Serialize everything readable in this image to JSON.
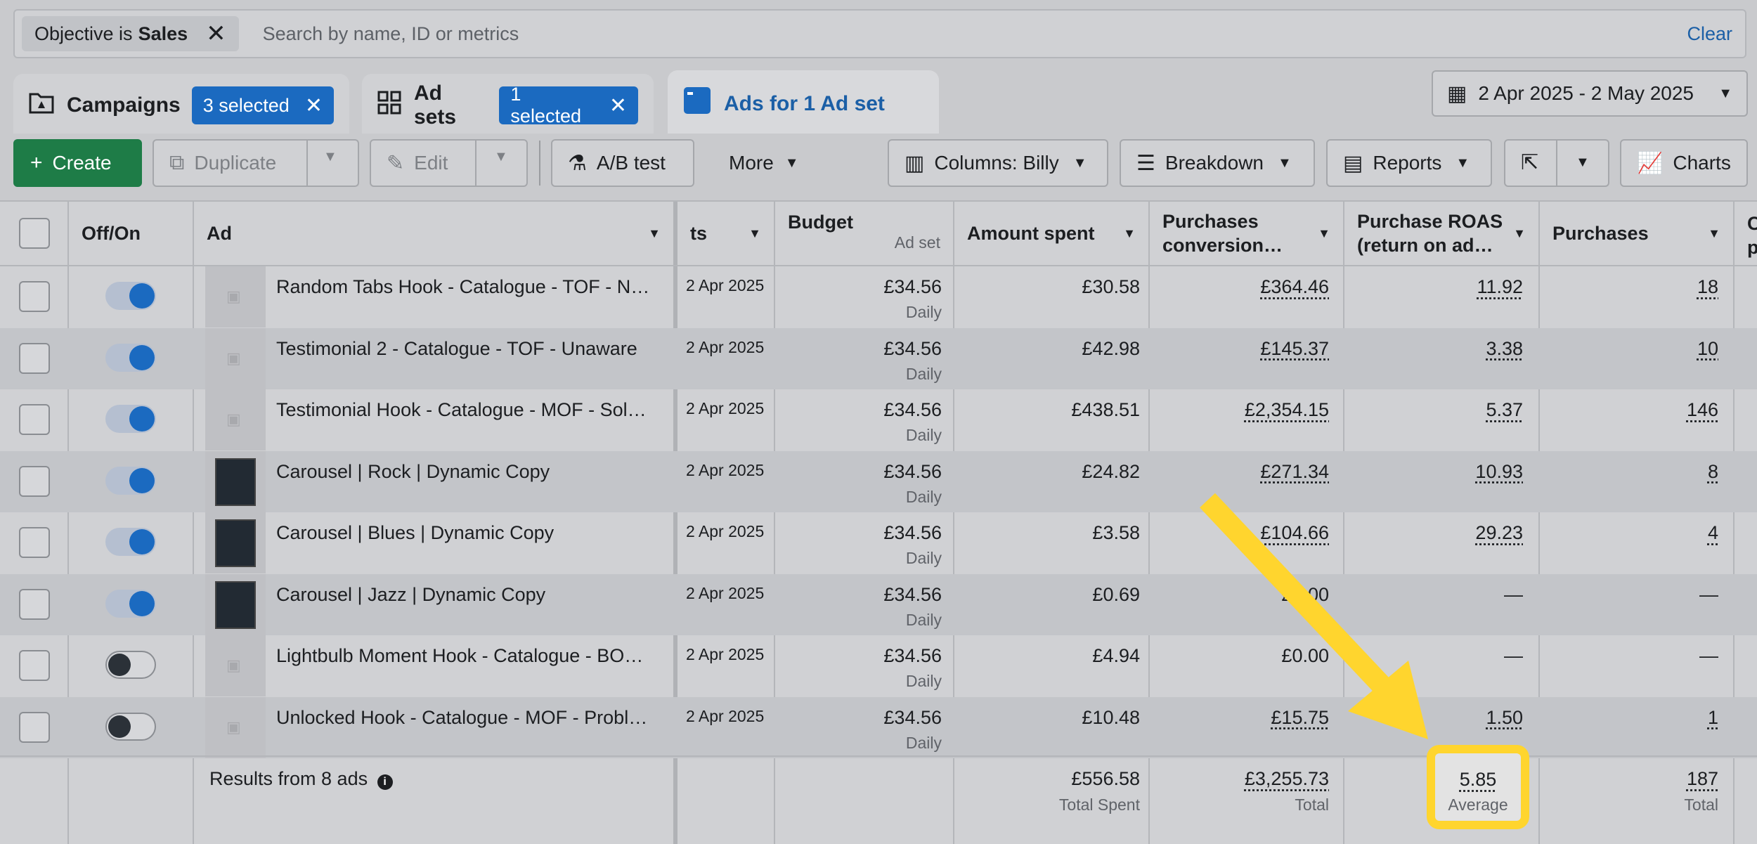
{
  "filter": {
    "chip_prefix": "Objective is",
    "chip_value": "Sales",
    "search_placeholder": "Search by name, ID or metrics",
    "clear": "Clear"
  },
  "tabs": {
    "campaigns": "Campaigns",
    "campaigns_selected": "3 selected",
    "adsets": "Ad sets",
    "adsets_selected": "1 selected",
    "ads": "Ads for 1 Ad set"
  },
  "date_range": "2 Apr 2025 - 2 May 2025",
  "toolbar": {
    "create": "Create",
    "duplicate": "Duplicate",
    "edit": "Edit",
    "ab_test": "A/B test",
    "more": "More",
    "columns": "Columns: Billy",
    "breakdown": "Breakdown",
    "reports": "Reports",
    "charts": "Charts"
  },
  "headers": {
    "offon": "Off/On",
    "ad": "Ad",
    "starts": "ts",
    "budget": "Budget",
    "budget_sub": "Ad set",
    "amount_spent": "Amount spent",
    "purchases_value_1": "Purchases",
    "purchases_value_2": "conversion…",
    "roas_1": "Purchase ROAS",
    "roas_2": "(return on ad…",
    "purchases": "Purchases",
    "next_1": "C",
    "next_2": "p"
  },
  "rows": [
    {
      "name": "Random Tabs Hook - Catalogue - TOF - N…",
      "start": "2 Apr 2025",
      "budget": "£34.56",
      "budget_sub": "Daily",
      "spent": "£30.58",
      "value": "£364.46",
      "roas": "11.92",
      "purchases": "18",
      "on": true,
      "thumb": "placeholder"
    },
    {
      "name": "Testimonial 2 - Catalogue - TOF - Unaware",
      "start": "2 Apr 2025",
      "budget": "£34.56",
      "budget_sub": "Daily",
      "spent": "£42.98",
      "value": "£145.37",
      "roas": "3.38",
      "purchases": "10",
      "on": true,
      "thumb": "placeholder"
    },
    {
      "name": "Testimonial Hook - Catalogue - MOF - Sol…",
      "start": "2 Apr 2025",
      "budget": "£34.56",
      "budget_sub": "Daily",
      "spent": "£438.51",
      "value": "£2,354.15",
      "roas": "5.37",
      "purchases": "146",
      "on": true,
      "thumb": "placeholder"
    },
    {
      "name": "Carousel | Rock | Dynamic Copy",
      "start": "2 Apr 2025",
      "budget": "£34.56",
      "budget_sub": "Daily",
      "spent": "£24.82",
      "value": "£271.34",
      "roas": "10.93",
      "purchases": "8",
      "on": true,
      "thumb": "image"
    },
    {
      "name": "Carousel | Blues | Dynamic Copy",
      "start": "2 Apr 2025",
      "budget": "£34.56",
      "budget_sub": "Daily",
      "spent": "£3.58",
      "value": "£104.66",
      "roas": "29.23",
      "purchases": "4",
      "on": true,
      "thumb": "image"
    },
    {
      "name": "Carousel | Jazz | Dynamic Copy",
      "start": "2 Apr 2025",
      "budget": "£34.56",
      "budget_sub": "Daily",
      "spent": "£0.69",
      "value": "£0.00",
      "roas": "—",
      "purchases": "—",
      "on": true,
      "thumb": "image"
    },
    {
      "name": "Lightbulb Moment Hook - Catalogue - BO…",
      "start": "2 Apr 2025",
      "budget": "£34.56",
      "budget_sub": "Daily",
      "spent": "£4.94",
      "value": "£0.00",
      "roas": "—",
      "purchases": "—",
      "on": false,
      "thumb": "placeholder"
    },
    {
      "name": "Unlocked Hook - Catalogue - MOF - Probl…",
      "start": "2 Apr 2025",
      "budget": "£34.56",
      "budget_sub": "Daily",
      "spent": "£10.48",
      "value": "£15.75",
      "roas": "1.50",
      "purchases": "1",
      "on": false,
      "thumb": "placeholder"
    }
  ],
  "totals": {
    "label": "Results from 8 ads",
    "spent": "£556.58",
    "spent_sub": "Total Spent",
    "value": "£3,255.73",
    "value_sub": "Total",
    "roas": "5.85",
    "roas_sub": "Average",
    "purchases": "187",
    "purchases_sub": "Total"
  },
  "colors": {
    "accent": "#1b6ac0",
    "create": "#1e7c47",
    "highlight": "#ffd52e"
  }
}
